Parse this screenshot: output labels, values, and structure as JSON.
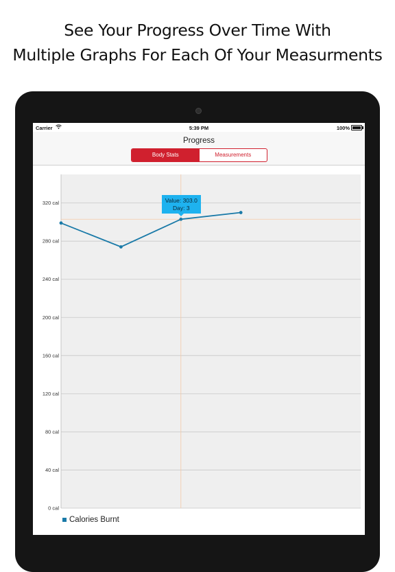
{
  "promo": {
    "line1": "See Your Progress Over Time With",
    "line2": "Multiple Graphs For Each Of Your Measurments"
  },
  "status_bar": {
    "carrier": "Carrier",
    "wifi_icon": "wifi-icon",
    "time": "5:39 PM",
    "battery_label": "100%",
    "battery_level": 1.0
  },
  "nav": {
    "title": "Progress",
    "segments": [
      {
        "label": "Body Stats",
        "selected": true
      },
      {
        "label": "Measurements",
        "selected": false
      }
    ]
  },
  "colors": {
    "accent": "#d0202e",
    "line": "#1a7aa8",
    "tooltip": "#1eb2ef",
    "plot_bg": "#efefef",
    "crosshair": "#f5c9a6"
  },
  "chart_data": {
    "type": "line",
    "series": [
      {
        "name": "Calories Burnt",
        "x": [
          1,
          2,
          3,
          4
        ],
        "values": [
          299,
          274,
          303,
          310
        ]
      }
    ],
    "ylim": [
      0,
      350
    ],
    "y_ticks": [
      0,
      40,
      80,
      120,
      160,
      200,
      240,
      280,
      320
    ],
    "y_tick_labels": [
      "0 cal",
      "40 cal",
      "80 cal",
      "120 cal",
      "160 cal",
      "200 cal",
      "240 cal",
      "280 cal",
      "320 cal"
    ],
    "xlim": [
      1,
      6
    ],
    "grid": true,
    "legend": "bottom-left",
    "tooltip": {
      "value_text": "Value: 303.0",
      "day_text": "Day: 3",
      "highlight_x": 3
    }
  }
}
